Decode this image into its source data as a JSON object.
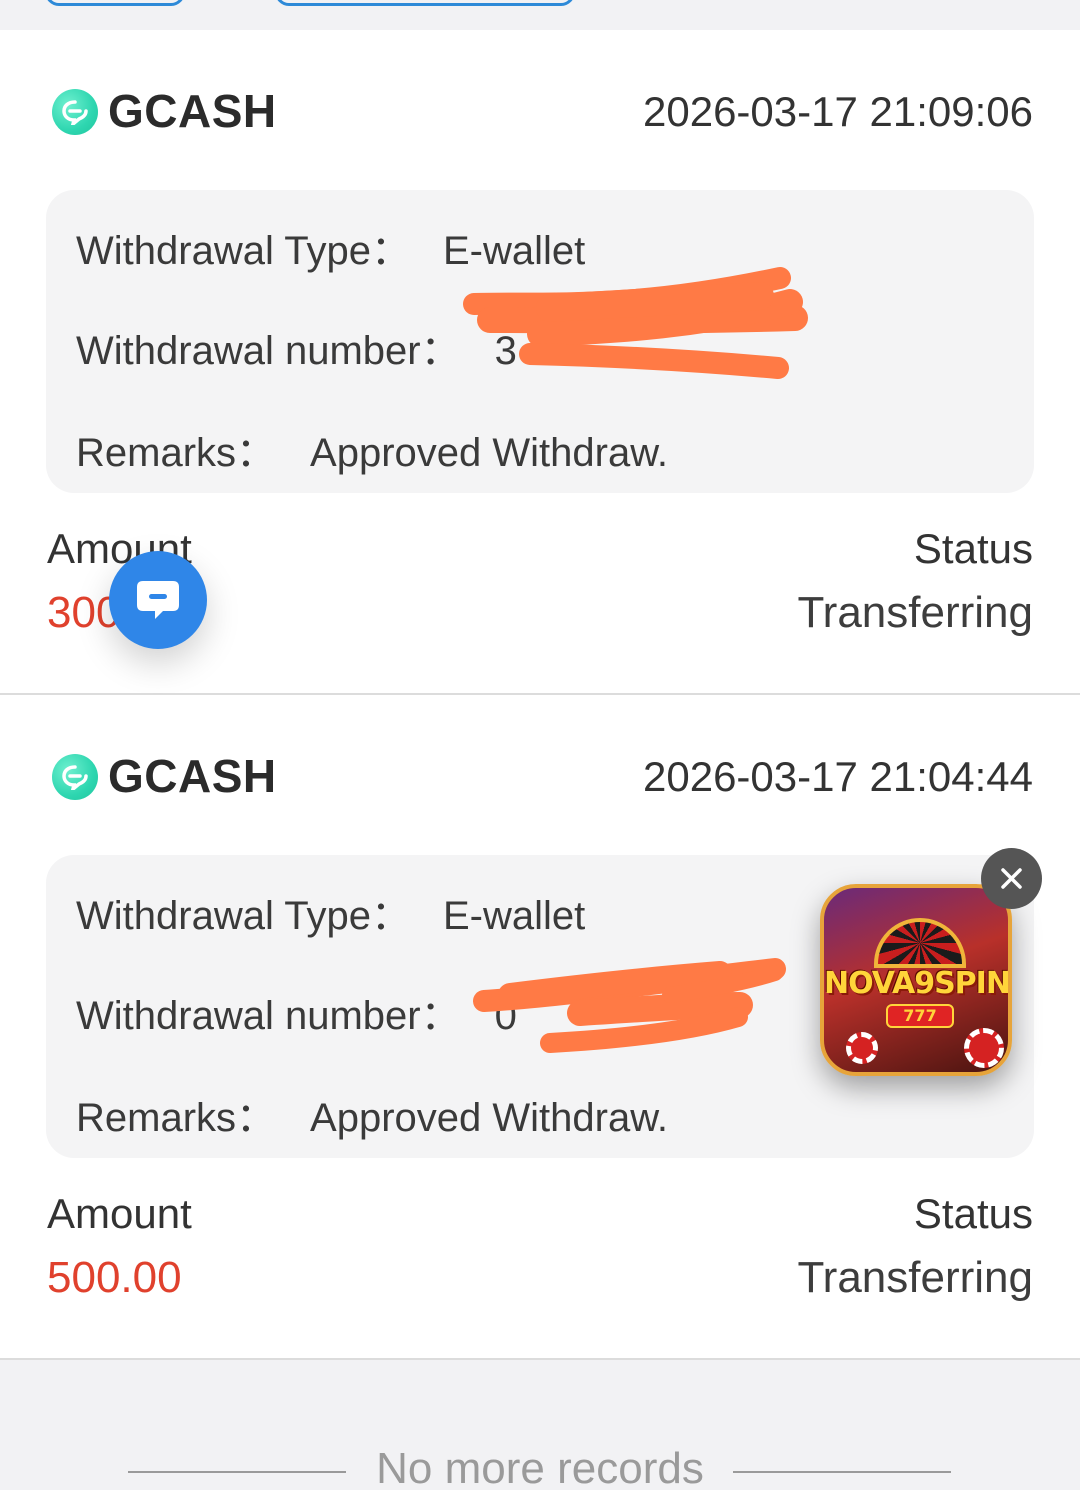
{
  "records": [
    {
      "brand": "GCASH",
      "time": "2026-03-17 21:09:06",
      "type_label": "Withdrawal Type：",
      "type_value": "E-wallet",
      "number_label": "Withdrawal number：",
      "number_value": "3",
      "remarks_label": "Remarks：",
      "remarks_value": "Approved Withdraw.",
      "amount_label": "Amount",
      "amount_value": "300",
      "status_label": "Status",
      "status_value": "Transferring"
    },
    {
      "brand": "GCASH",
      "time": "2026-03-17 21:04:44",
      "type_label": "Withdrawal Type：",
      "type_value": "E-wallet",
      "number_label": "Withdrawal number：",
      "number_value": "0",
      "remarks_label": "Remarks：",
      "remarks_value": "Approved Withdraw.",
      "amount_label": "Amount",
      "amount_value": "500.00",
      "status_label": "Status",
      "status_value": "Transferring"
    }
  ],
  "promo": {
    "title": "NOVA9SPIN",
    "sub": "777"
  },
  "footer": {
    "text": "No more records"
  },
  "colors": {
    "accent": "#2f86e8",
    "amount": "#e0412d",
    "gcash": "#2ed6b0",
    "redaction": "#ff7a45"
  },
  "icons": {
    "brand": "gcash-logo-icon",
    "chat": "chat-bubble-icon",
    "close": "close-icon"
  }
}
